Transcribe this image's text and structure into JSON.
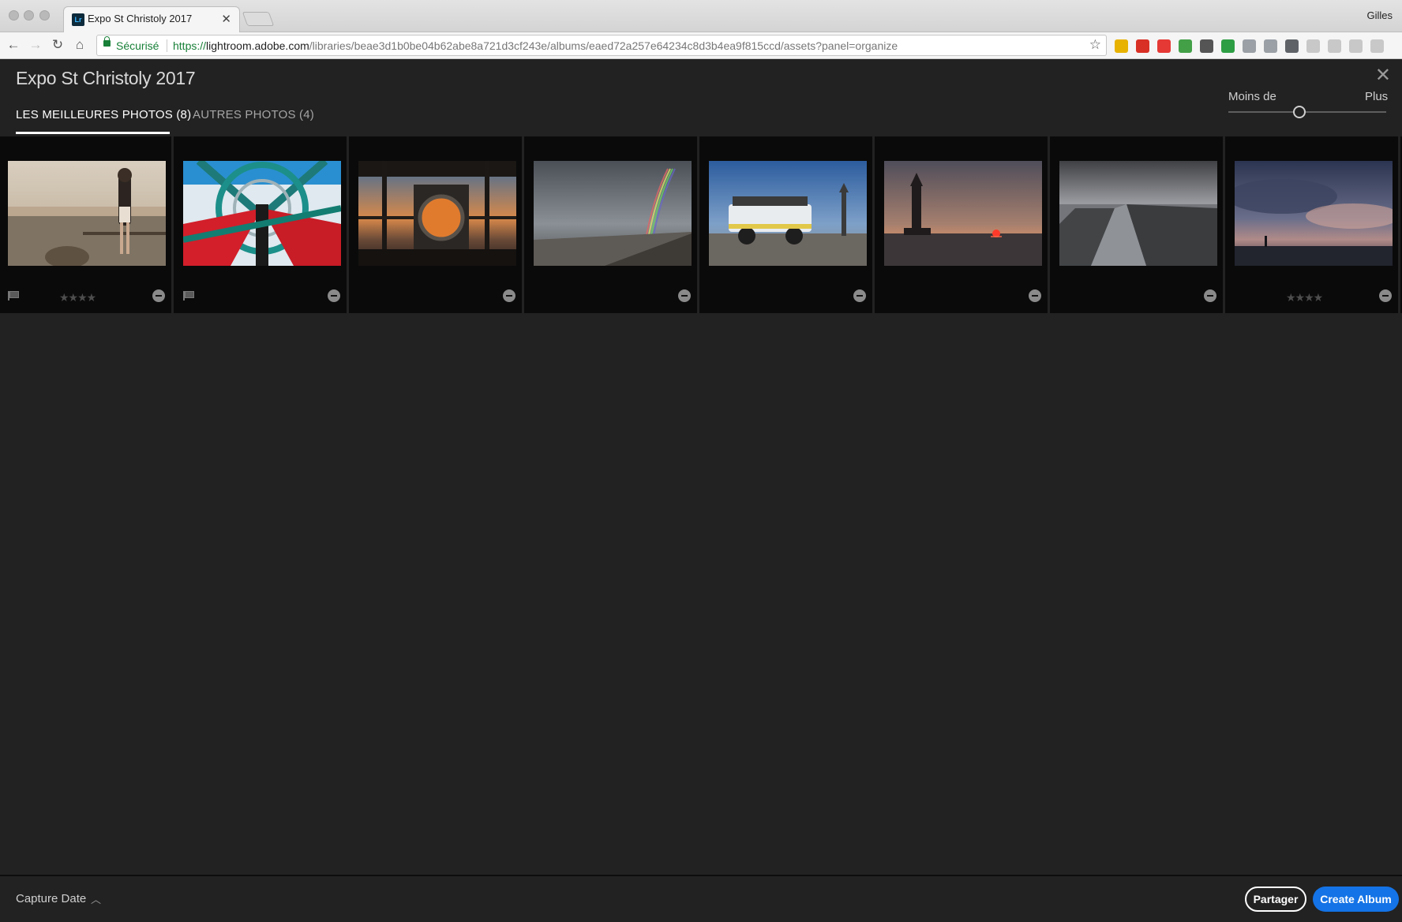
{
  "browser": {
    "tab_title": "Expo St Christoly 2017",
    "favicon_text": "Lr",
    "profile_name": "Gilles",
    "secure_label": "Sécurisé",
    "url_scheme": "https://",
    "url_host": "lightroom.adobe.com",
    "url_path": "/libraries/beae3d1b0be04b62abe8a721d3cf243e/albums/eaed72a257e64234c8d3b4ea9f815ccd/assets?panel=organize",
    "extension_colors": [
      "#e8b200",
      "#d93025",
      "#e53935",
      "#43a047",
      "#555555",
      "#2e9e44",
      "#9aa0a6",
      "#9aa0a6",
      "#5f6368",
      "#c8c8c8",
      "#c8c8c8",
      "#c8c8c8",
      "#c8c8c8"
    ]
  },
  "header": {
    "album_title": "Expo St Christoly 2017",
    "tabs": [
      {
        "label": "LES MEILLEURES PHOTOS (8)",
        "active": true
      },
      {
        "label": "AUTRES PHOTOS (4)",
        "active": false
      }
    ],
    "size_slider": {
      "less_label": "Moins de",
      "more_label": "Plus",
      "value": 0.45
    }
  },
  "photos": [
    {
      "scene": "woman-harbor",
      "flagged": true,
      "rating": 4
    },
    {
      "scene": "lighthouse-lens",
      "flagged": true,
      "rating": 0
    },
    {
      "scene": "lantern-room-sunset",
      "flagged": false,
      "rating": 0
    },
    {
      "scene": "rainbow-beach",
      "flagged": false,
      "rating": 0
    },
    {
      "scene": "amphibious-vehicle",
      "flagged": false,
      "rating": 0
    },
    {
      "scene": "lighthouse-sunset",
      "flagged": false,
      "rating": 0
    },
    {
      "scene": "stormy-breakwater",
      "flagged": false,
      "rating": 0
    },
    {
      "scene": "cloudy-dusk-lighthouse",
      "flagged": false,
      "rating": 4
    }
  ],
  "footer": {
    "sort_label": "Capture Date",
    "share_label": "Partager",
    "create_label": "Create Album",
    "accent": "#1473e6"
  }
}
